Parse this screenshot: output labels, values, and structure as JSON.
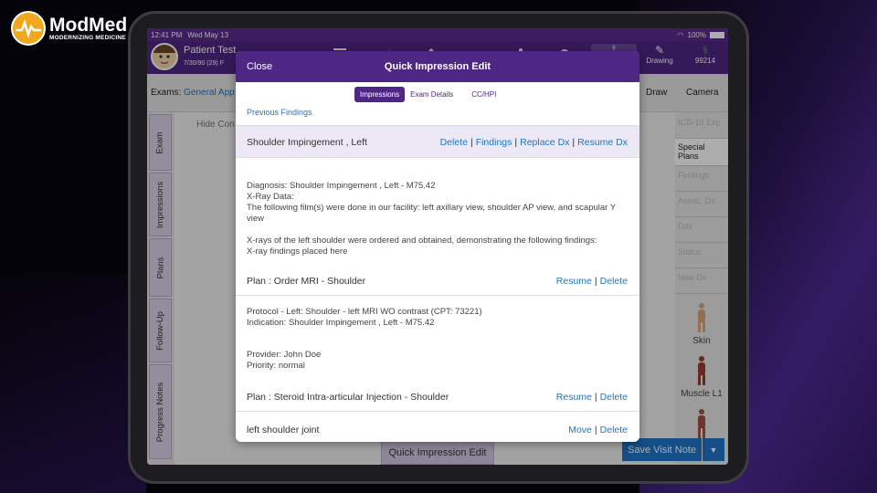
{
  "brand": {
    "name": "ModMed",
    "tagline": "MODERNIZING MEDICINE"
  },
  "status_bar": {
    "time": "12:41 PM",
    "date": "Wed May 13",
    "battery": "100%"
  },
  "patient": {
    "name": "Patient Test",
    "info": "7/30/90 (29) F"
  },
  "toolbar": {
    "drawing_label": "Drawing",
    "code_label": "99214"
  },
  "exams": {
    "label": "Exams:",
    "value": "General App",
    "draw": "Draw",
    "camera": "Camera"
  },
  "left_tabs": [
    "Exam",
    "Impressions",
    "Plans",
    "Follow-Up",
    "Progress Notes"
  ],
  "workarea": {
    "hide_label": "Hide Con"
  },
  "right_panel": {
    "buttons": [
      "ICD-10 Exp",
      "Special Plans",
      "Findings",
      "Assoc. Dx",
      "Ddx",
      "Status",
      "New Dx"
    ],
    "figures": [
      "Skin",
      "Muscle L1"
    ]
  },
  "bottom": {
    "quick_impression": "Quick Impression Edit",
    "save": "Save Visit Note"
  },
  "modal": {
    "close": "Close",
    "title": "Quick Impression Edit",
    "segments": [
      "Impressions",
      "Exam Details",
      "CC/HPI"
    ],
    "previous_findings": "Previous Findings",
    "selected": {
      "title": "Shoulder Impingement , Left",
      "actions": [
        "Delete",
        "Findings",
        "Replace Dx",
        "Resume Dx"
      ]
    },
    "diagnosis_block": [
      "Diagnosis: Shoulder Impingement , Left - M75.42",
      "X-Ray Data:",
      "The following film(s) were done in our facility: left axillary view, shoulder AP view, and scapular Y view"
    ],
    "xray_block": [
      "X-rays of the left shoulder were ordered and obtained, demonstrating the following findings:",
      "X-ray findings placed here"
    ],
    "plan1": {
      "title": "Plan : Order MRI - Shoulder",
      "actions": [
        "Resume",
        "Delete"
      ]
    },
    "protocol_block": [
      "Protocol - Left: Shoulder - left MRI WO contrast (CPT: 73221)",
      "Indication: Shoulder Impingement , Left - M75.42"
    ],
    "provider_block": [
      "Provider: John Doe",
      "Priority: normal"
    ],
    "plan2": {
      "title": "Plan : Steroid Intra-articular Injection - Shoulder",
      "actions": [
        "Resume",
        "Delete"
      ]
    },
    "plan3": {
      "title": "left shoulder joint",
      "actions": [
        "Move",
        "Delete"
      ]
    }
  }
}
